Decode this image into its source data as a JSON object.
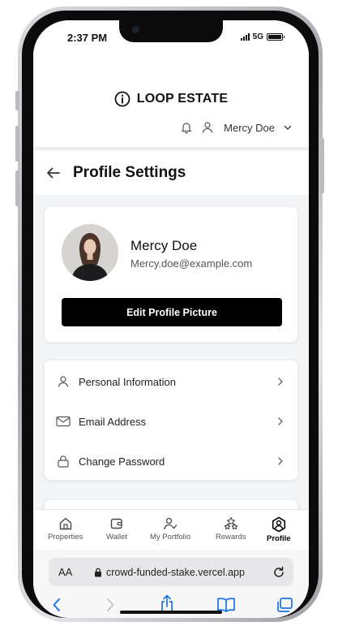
{
  "status_bar": {
    "time": "2:37 PM",
    "network": "5G"
  },
  "header": {
    "brand": "LOOP ESTATE",
    "user_name": "Mercy Doe"
  },
  "page": {
    "title": "Profile Settings"
  },
  "profile": {
    "name": "Mercy Doe",
    "email": "Mercy.doe@example.com",
    "edit_label": "Edit Profile Picture"
  },
  "settings": [
    {
      "label": "Personal Information",
      "icon": "user-icon"
    },
    {
      "label": "Email Address",
      "icon": "mail-icon"
    },
    {
      "label": "Change Password",
      "icon": "lock-icon"
    }
  ],
  "nav": [
    {
      "label": "Properties",
      "icon": "home-icon",
      "active": false
    },
    {
      "label": "Wallet",
      "icon": "wallet-icon",
      "active": false
    },
    {
      "label": "My Portfolio",
      "icon": "portfolio-icon",
      "active": false
    },
    {
      "label": "Rewards",
      "icon": "rewards-icon",
      "active": false
    },
    {
      "label": "Profile",
      "icon": "profile-icon",
      "active": true
    }
  ],
  "browser": {
    "aa": "AA",
    "url": "crowd-funded-stake.vercel.app"
  },
  "colors": {
    "accent": "#000000",
    "safari_blue": "#1a73e8",
    "background": "#f3f4f6"
  }
}
